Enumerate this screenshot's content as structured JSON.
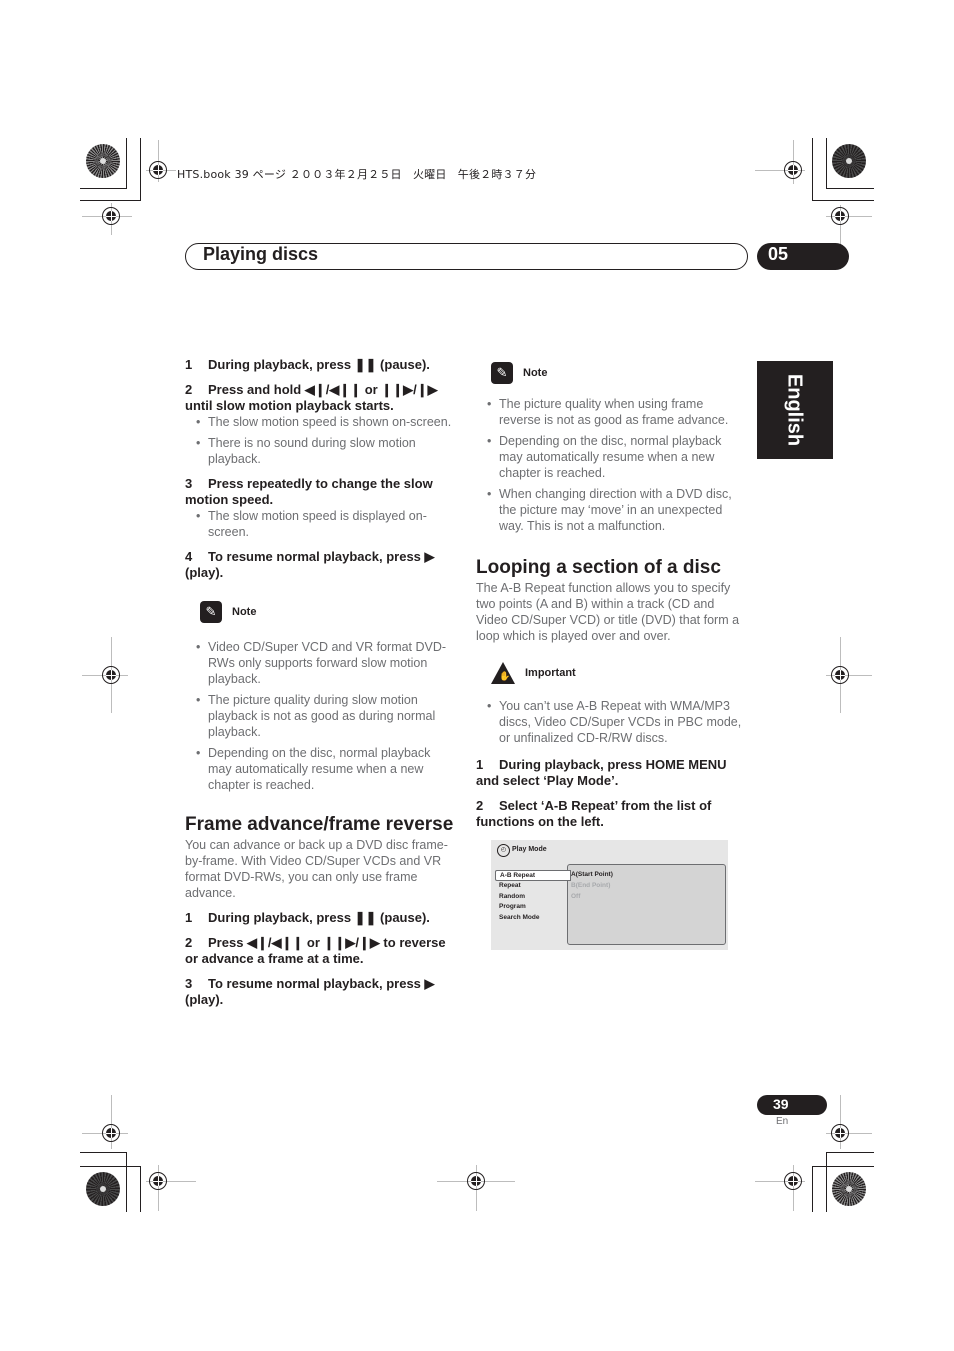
{
  "book_meta": "HTS.book  39 ページ  ２００３年２月２５日　火曜日　午後２時３７分",
  "header": {
    "title": "Playing discs",
    "chapter": "05"
  },
  "language_tab": "English",
  "left_column": {
    "steps_slow": [
      {
        "num": "1",
        "text": "During playback, press ❚❚ (pause)."
      },
      {
        "num": "2",
        "text": "Press and hold ◀❙/◀❙❙ or ❙❙▶/❙▶ until slow motion playback starts."
      },
      {
        "num": "3",
        "text": "Press repeatedly to change the slow motion speed."
      },
      {
        "num": "4",
        "text": "To resume normal playback, press ▶ (play)."
      }
    ],
    "step2_bullets": [
      "The slow motion speed is shown on-screen.",
      "There is no sound during slow motion playback."
    ],
    "step3_bullets": [
      "The slow motion speed is displayed on-screen."
    ],
    "note": {
      "label": "Note",
      "items": [
        "Video CD/Super VCD and VR format DVD-RWs only supports forward slow motion playback.",
        "The picture quality during slow motion playback is not as good as during normal playback.",
        "Depending on the disc, normal playback may automatically resume when a new chapter is reached."
      ]
    },
    "frame_section": {
      "heading": "Frame advance/frame reverse",
      "intro": "You can advance or back up a DVD disc frame-by-frame. With Video CD/Super VCDs and VR format DVD-RWs, you can only use frame advance.",
      "steps": [
        {
          "num": "1",
          "text": "During playback, press ❚❚ (pause)."
        },
        {
          "num": "2",
          "text": "Press ◀❙/◀❙❙ or ❙❙▶/❙▶ to reverse or advance a frame at a time."
        },
        {
          "num": "3",
          "text": "To resume normal playback, press ▶ (play)."
        }
      ]
    }
  },
  "right_column": {
    "note": {
      "label": "Note",
      "items": [
        "The picture quality when using frame reverse is not as good as frame advance.",
        "Depending on the disc, normal playback may automatically resume when a new chapter is reached.",
        "When changing direction with a DVD disc, the picture may ‘move’ in an unexpected way. This is not a malfunction."
      ]
    },
    "loop_section": {
      "heading": "Looping a section of a disc",
      "intro": "The A-B Repeat function allows you to specify two points (A and B) within a track (CD and Video CD/Super VCD) or title (DVD) that form a loop which is played over and over.",
      "important": {
        "label": "Important",
        "items": [
          "You can’t use A-B Repeat with WMA/MP3 discs, Video CD/Super VCDs in PBC mode, or unfinalized CD-R/RW discs."
        ]
      },
      "steps": [
        {
          "num": "1",
          "text": "During playback, press HOME MENU and select ‘Play Mode’."
        },
        {
          "num": "2",
          "text": "Select ‘A-B Repeat’ from the list of functions on the left."
        }
      ]
    },
    "screen": {
      "title": "Play Mode",
      "menu": [
        "A-B Repeat",
        "Repeat",
        "Random",
        "Program",
        "Search Mode"
      ],
      "selected": "A-B Repeat",
      "options": [
        {
          "label": "A(Start Point)",
          "enabled": true
        },
        {
          "label": "B(End Point)",
          "enabled": false
        },
        {
          "label": "Off",
          "enabled": false
        }
      ]
    }
  },
  "footer": {
    "page_number": "39",
    "page_lang": "En"
  }
}
